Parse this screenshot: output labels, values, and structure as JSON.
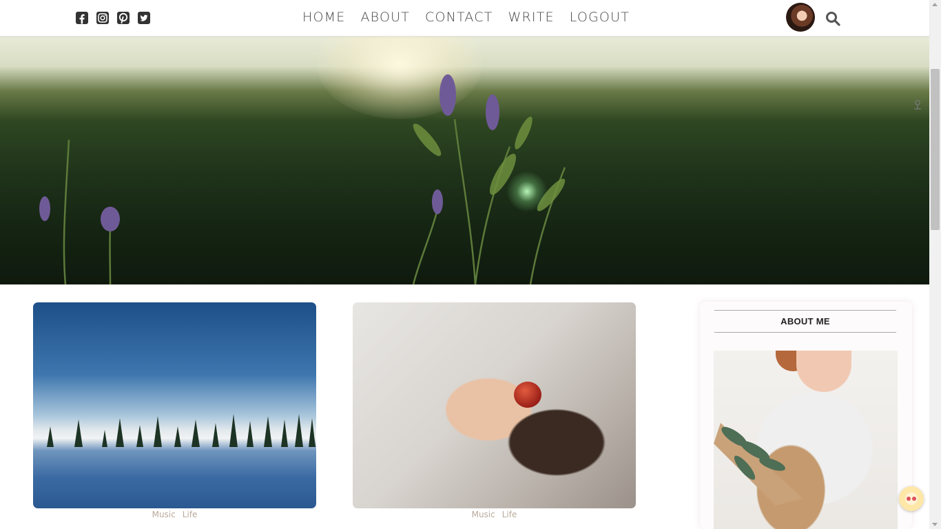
{
  "nav": {
    "social_icons": [
      "facebook-icon",
      "instagram-icon",
      "pinterest-icon",
      "twitter-icon"
    ],
    "links": [
      "HOME",
      "ABOUT",
      "CONTACT",
      "WRITE",
      "LOGOUT"
    ]
  },
  "posts": [
    {
      "categories": [
        "Music",
        "Life"
      ]
    },
    {
      "categories": [
        "Music",
        "Life"
      ]
    }
  ],
  "sidebar": {
    "title": "ABOUT ME"
  },
  "colors": {
    "nav_text": "#444444",
    "category_text": "#b9a99c",
    "divider": "#a8a8a8"
  }
}
